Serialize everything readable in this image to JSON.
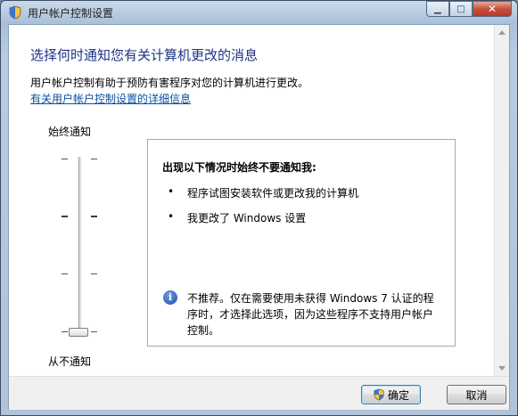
{
  "window": {
    "title": "用户帐户控制设置"
  },
  "caption_buttons": {
    "minimize": "▁",
    "maximize": "□",
    "close": "✕"
  },
  "header": {
    "heading": "选择何时通知您有关计算机更改的消息",
    "description": "用户帐户控制有助于预防有害程序对您的计算机进行更改。",
    "help_link": "有关用户帐户控制设置的详细信息"
  },
  "slider": {
    "top_label": "始终通知",
    "bottom_label": "从不通知",
    "level_count": 4,
    "selected_level": 1
  },
  "info_panel": {
    "title": "出现以下情况时始终不要通知我:",
    "bullet_glyph": "•",
    "bullets": [
      "程序试图安装软件或更改我的计算机",
      "我更改了 Windows 设置"
    ],
    "note": "不推荐。仅在需要使用未获得 Windows 7 认证的程序时，才选择此选项，因为这些程序不支持用户帐户控制。",
    "note_icon": "info-icon"
  },
  "footer": {
    "ok_label": "确定",
    "cancel_label": "取消"
  },
  "colors": {
    "heading": "#1e3287",
    "link": "#0a4fa3",
    "close_button": "#c7503c"
  }
}
